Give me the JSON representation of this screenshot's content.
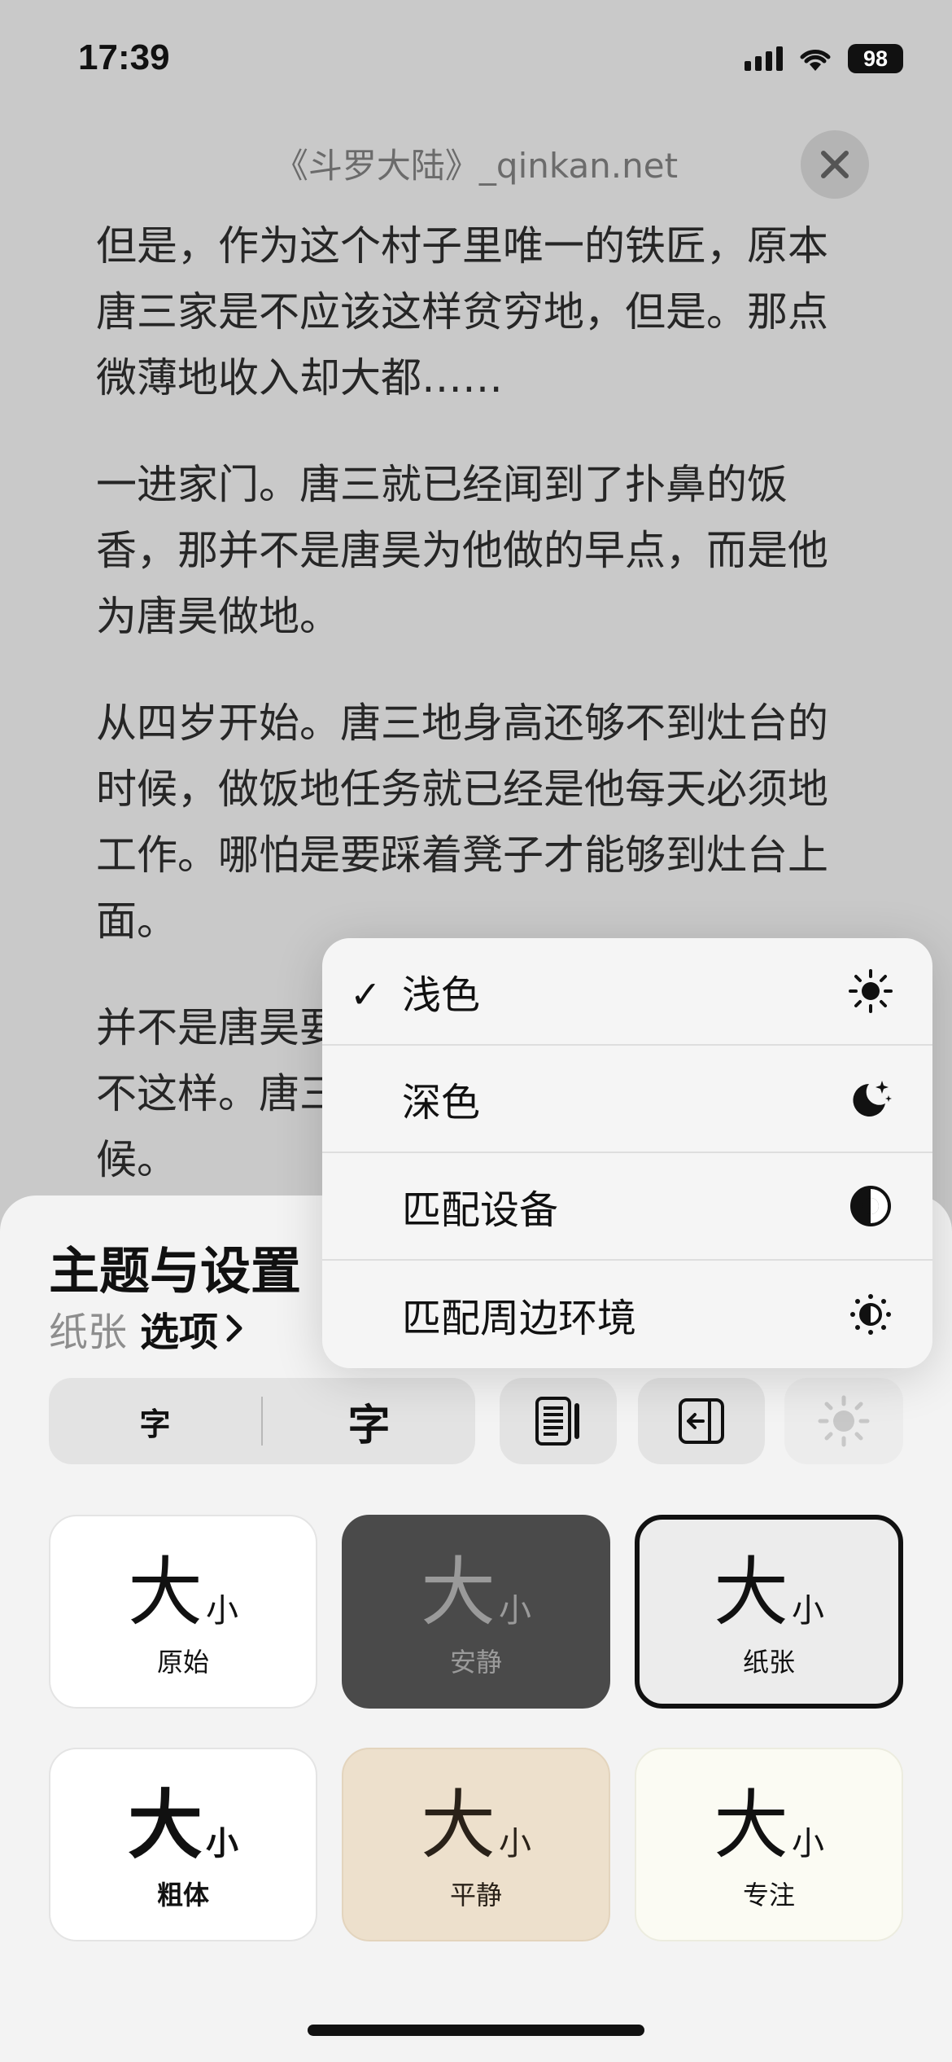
{
  "status_bar": {
    "time": "17:39",
    "battery": "98"
  },
  "reader": {
    "book_title": "《斗罗大陆》_qinkan.net",
    "paragraphs": [
      "但是，作为这个村子里唯一的铁匠，原本唐三家是不应该这样贫穷地，但是。那点微薄地收入却大都……",
      "一进家门。唐三就已经闻到了扑鼻的饭香，那并不是唐昊为他做的早点，而是他为唐昊做地。",
      "从四岁开始。唐三地身高还够不到灶台的时候，做饭地任务就已经是他每天必须地工作。哪怕是要踩着凳子才能够到灶台上面。",
      "并不是唐昊要求他这样做的，而是他不得不这样。唐三一直觉得这是他应该做的时候。"
    ]
  },
  "appearance_menu": {
    "items": [
      {
        "label": "浅色",
        "checked": true,
        "icon": "sun-icon"
      },
      {
        "label": "深色",
        "checked": false,
        "icon": "moon-stars-icon"
      },
      {
        "label": "匹配设备",
        "checked": false,
        "icon": "half-circle-icon"
      },
      {
        "label": "匹配周边环境",
        "checked": false,
        "icon": "auto-brightness-icon"
      }
    ],
    "check_glyph": "✓"
  },
  "sheet": {
    "title": "主题与设置",
    "current_theme": "纸张",
    "options_label": "选项",
    "font_smaller": "字",
    "font_larger": "字",
    "themes": [
      {
        "name": "原始",
        "big": "大",
        "small": "小"
      },
      {
        "name": "安静",
        "big": "大",
        "small": "小"
      },
      {
        "name": "纸张",
        "big": "大",
        "small": "小",
        "selected": true
      },
      {
        "name": "粗体",
        "big": "大",
        "small": "小"
      },
      {
        "name": "平静",
        "big": "大",
        "small": "小"
      },
      {
        "name": "专注",
        "big": "大",
        "small": "小"
      }
    ]
  },
  "colors": {
    "quiet_bg": "#4a4a4a",
    "calm_bg": "#ede0cc",
    "focus_bg": "#fbfbf3",
    "dim_overlay": "#c9c9c9"
  }
}
